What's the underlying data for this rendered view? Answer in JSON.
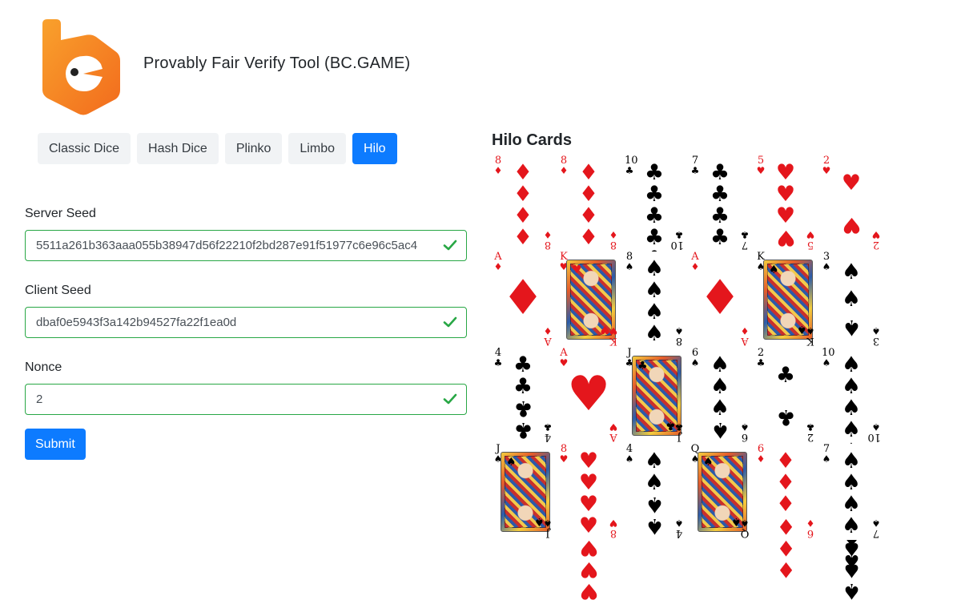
{
  "header": {
    "title": "Provably Fair Verify Tool (BC.GAME)",
    "logo_color": "#f7931e"
  },
  "tabs": [
    {
      "label": "Classic Dice",
      "active": false
    },
    {
      "label": "Hash Dice",
      "active": false
    },
    {
      "label": "Plinko",
      "active": false
    },
    {
      "label": "Limbo",
      "active": false
    },
    {
      "label": "Hilo",
      "active": true
    }
  ],
  "form": {
    "server_seed": {
      "label": "Server Seed",
      "value": "5511a261b363aaa055b38947d56f22210f2bd287e91f51977c6e96c5ac4",
      "valid": true
    },
    "client_seed": {
      "label": "Client Seed",
      "value": "dbaf0e5943f3a142b94527fa22f1ea0d",
      "valid": true
    },
    "nonce": {
      "label": "Nonce",
      "value": "2",
      "valid": true
    },
    "submit_label": "Submit"
  },
  "cards_panel": {
    "title": "Hilo Cards",
    "cards": [
      {
        "rank": "8",
        "suit": "♦"
      },
      {
        "rank": "8",
        "suit": "♦"
      },
      {
        "rank": "10",
        "suit": "♣"
      },
      {
        "rank": "7",
        "suit": "♣"
      },
      {
        "rank": "5",
        "suit": "♥"
      },
      {
        "rank": "2",
        "suit": "♥"
      },
      {
        "rank": "A",
        "suit": "♦"
      },
      {
        "rank": "K",
        "suit": "♥"
      },
      {
        "rank": "8",
        "suit": "♠"
      },
      {
        "rank": "A",
        "suit": "♦"
      },
      {
        "rank": "K",
        "suit": "♠"
      },
      {
        "rank": "3",
        "suit": "♠"
      },
      {
        "rank": "4",
        "suit": "♣"
      },
      {
        "rank": "A",
        "suit": "♥"
      },
      {
        "rank": "J",
        "suit": "♣"
      },
      {
        "rank": "6",
        "suit": "♠"
      },
      {
        "rank": "2",
        "suit": "♣"
      },
      {
        "rank": "10",
        "suit": "♠"
      },
      {
        "rank": "J",
        "suit": "♠"
      },
      {
        "rank": "8",
        "suit": "♥"
      },
      {
        "rank": "4",
        "suit": "♠"
      },
      {
        "rank": "Q",
        "suit": "♠"
      },
      {
        "rank": "6",
        "suit": "♦"
      },
      {
        "rank": "7",
        "suit": "♠"
      }
    ]
  },
  "colors": {
    "primary": "#0d7bff",
    "valid": "#28a745",
    "red_suit": "#e4161c"
  }
}
